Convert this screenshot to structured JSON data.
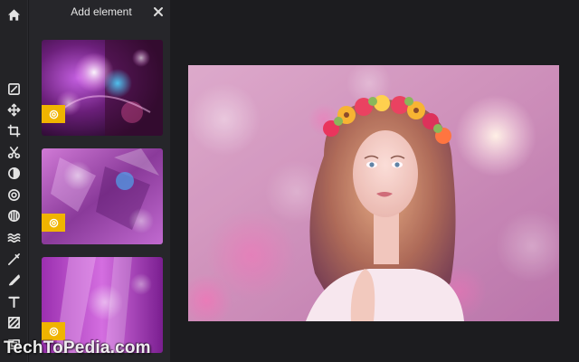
{
  "panel": {
    "title": "Add element",
    "thumbnails": [
      {
        "badge_icon": "premium-badge-icon"
      },
      {
        "badge_icon": "premium-badge-icon"
      },
      {
        "badge_icon": "premium-badge-icon"
      }
    ]
  },
  "toolbar": {
    "items": [
      "home-icon",
      "adjust-icon",
      "move-icon",
      "crop-icon",
      "cut-icon",
      "exposure-icon",
      "filter-icon",
      "color-icon",
      "wave-icon",
      "brush-icon",
      "draw-icon",
      "text-icon",
      "texture-icon",
      "frame-icon"
    ]
  },
  "colors": {
    "background": "#1c1c1f",
    "panel": "#26262a",
    "badge": "#f0b400"
  },
  "watermark": "TechToPedia.com"
}
